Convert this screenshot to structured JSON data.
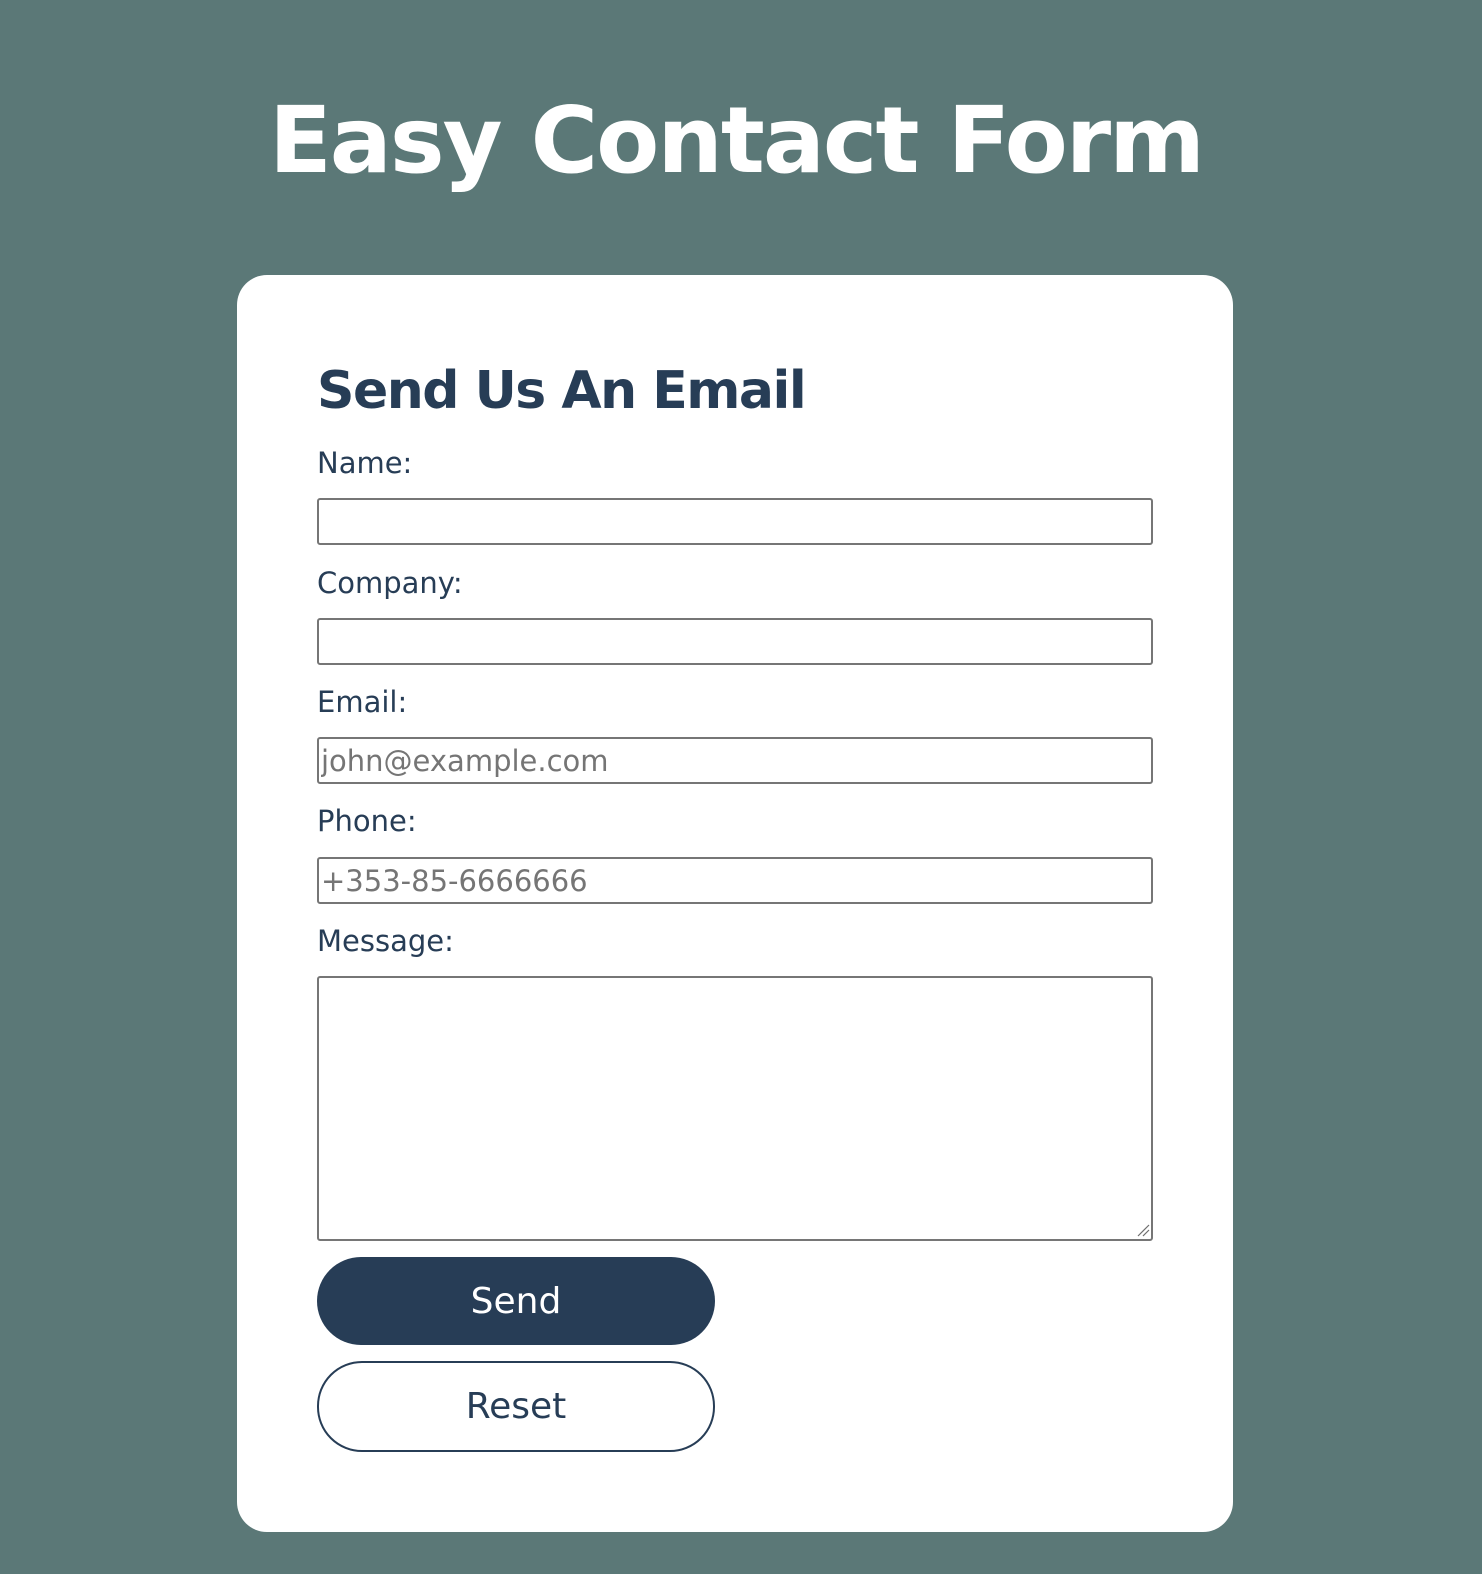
{
  "page": {
    "title": "Easy Contact Form",
    "background_color": "#5b7877"
  },
  "form": {
    "heading": "Send Us An Email",
    "accent_color": "#273d56",
    "fields": {
      "name": {
        "label": "Name:",
        "value": "",
        "placeholder": ""
      },
      "company": {
        "label": "Company:",
        "value": "",
        "placeholder": ""
      },
      "email": {
        "label": "Email:",
        "value": "",
        "placeholder": "john@example.com"
      },
      "phone": {
        "label": "Phone:",
        "value": "",
        "placeholder": "+353-85-6666666"
      },
      "message": {
        "label": "Message:",
        "value": ""
      }
    },
    "buttons": {
      "send_label": "Send",
      "reset_label": "Reset"
    }
  }
}
